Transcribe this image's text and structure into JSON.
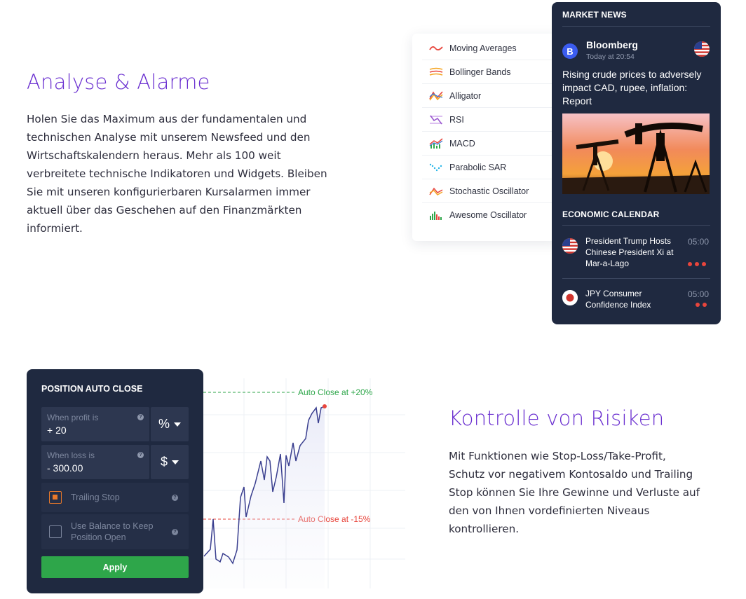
{
  "analyse": {
    "title": "Analyse & Alarme",
    "lines": [
      "Holen Sie das Maximum aus der fundamentalen und",
      "technischen Analyse mit unserem Newsfeed und den",
      "Wirtschaftskalendern heraus. Mehr als 100 weit",
      "verbreitete technische Indikatoren und Widgets. Bleiben",
      "Sie mit unseren konfigurierbaren Kursalarmen immer",
      "aktuell über das Geschehen auf den Finanzmärkten",
      "informiert."
    ]
  },
  "indicators": [
    {
      "label": "Moving Averages",
      "icon": "moving-averages-icon"
    },
    {
      "label": "Bollinger Bands",
      "icon": "bollinger-bands-icon"
    },
    {
      "label": "Alligator",
      "icon": "alligator-icon"
    },
    {
      "label": "RSI",
      "icon": "rsi-icon"
    },
    {
      "label": "MACD",
      "icon": "macd-icon"
    },
    {
      "label": "Parabolic SAR",
      "icon": "parabolic-sar-icon"
    },
    {
      "label": "Stochastic Oscillator",
      "icon": "stochastic-oscillator-icon"
    },
    {
      "label": "Awesome Oscillator",
      "icon": "awesome-oscillator-icon"
    }
  ],
  "news": {
    "header": "MARKET NEWS",
    "source": "Bloomberg",
    "source_logo_letter": "B",
    "time": "Today at 20:54",
    "headline": "Rising crude prices to adversely impact CAD, rupee, inflation: Report",
    "calendar_header": "ECONOMIC CALENDAR",
    "events": [
      {
        "title": "President Trump Hosts Chinese President Xi at Mar-a-Lago",
        "time": "05:00",
        "importance": 3,
        "flag": "us-flag-icon"
      },
      {
        "title": "JPY Consumer Confidence Index",
        "time": "05:00",
        "importance": 2,
        "flag": "japan-flag-icon"
      }
    ]
  },
  "auto_close": {
    "title": "POSITION AUTO CLOSE",
    "profit_label": "When profit is",
    "profit_value": "+ 20",
    "profit_unit": "%",
    "loss_label": "When loss is",
    "loss_value": "- 300.00",
    "loss_unit": "$",
    "trailing_label": "Trailing Stop",
    "trailing_checked": true,
    "balance_label_1": "Use Balance to Keep",
    "balance_label_2": "Position Open",
    "balance_checked": false,
    "apply_label": "Apply",
    "help_glyph": "?"
  },
  "risk_chart": {
    "upper_label": "Auto Close at +20%",
    "lower_label": "Auto Close at -15%",
    "colors": {
      "upper": "#2ea64a",
      "lower": "#e8453c",
      "line": "#3a3f8f"
    }
  },
  "risiken": {
    "title": "Kontrolle von Risiken",
    "lines": [
      "Mit Funktionen wie Stop-Loss/Take-Profit,",
      "Schutz vor negativem Kontosaldo und Trailing",
      "Stop können Sie Ihre Gewinne und Verluste auf",
      "den von Ihnen vordefinierten Niveaus",
      "kontrollieren."
    ]
  },
  "colors": {
    "accent": "#6a2fd0",
    "panel": "#1f2940",
    "apply": "#2ea64a",
    "alert": "#e8453c"
  }
}
